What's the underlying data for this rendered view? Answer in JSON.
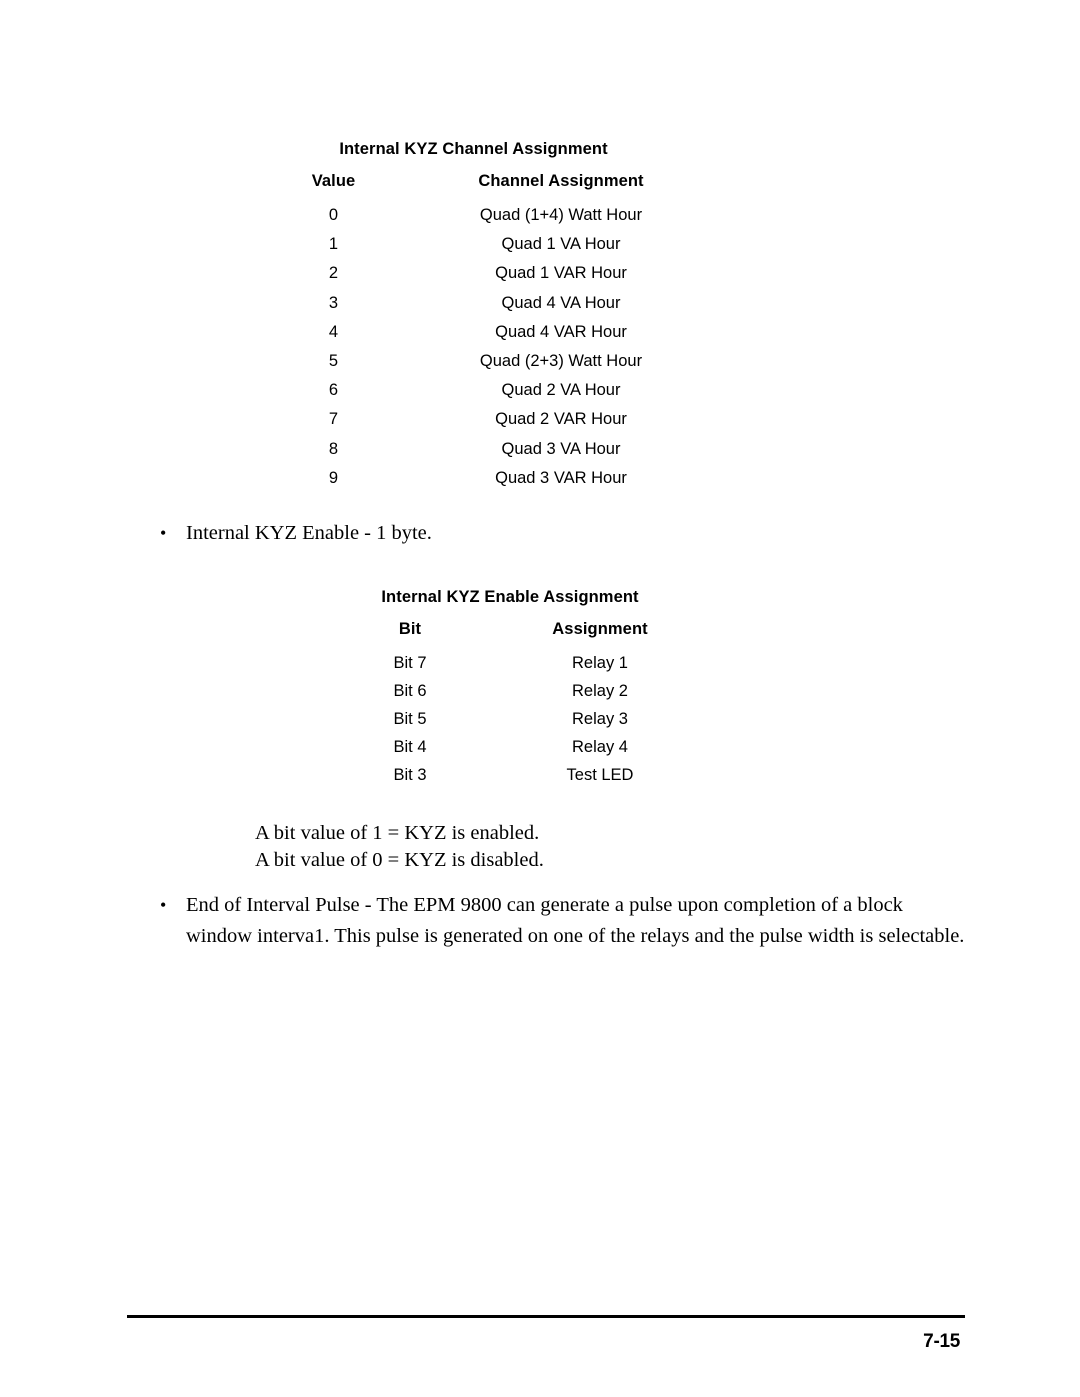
{
  "document": {
    "page_number": "7-15"
  },
  "table_channel_assignment": {
    "title": "Internal KYZ Channel Assignment",
    "headers": {
      "value": "Value",
      "assignment": "Channel Assignment"
    },
    "rows": [
      {
        "value": "0",
        "assignment": "Quad (1+4) Watt Hour"
      },
      {
        "value": "1",
        "assignment": "Quad 1 VA Hour"
      },
      {
        "value": "2",
        "assignment": "Quad 1 VAR Hour"
      },
      {
        "value": "3",
        "assignment": "Quad 4 VA Hour"
      },
      {
        "value": "4",
        "assignment": "Quad 4 VAR Hour"
      },
      {
        "value": "5",
        "assignment": "Quad (2+3) Watt Hour"
      },
      {
        "value": "6",
        "assignment": "Quad 2 VA Hour"
      },
      {
        "value": "7",
        "assignment": "Quad 2 VAR Hour"
      },
      {
        "value": "8",
        "assignment": "Quad 3 VA Hour"
      },
      {
        "value": "9",
        "assignment": "Quad 3 VAR Hour"
      }
    ]
  },
  "bullet_kyz_enable": {
    "glyph": "•",
    "text": "Internal KYZ Enable - 1 byte."
  },
  "table_enable_assignment": {
    "title": "Internal KYZ Enable Assignment",
    "headers": {
      "bit": "Bit",
      "assignment": "Assignment"
    },
    "rows": [
      {
        "bit": "Bit 7",
        "assignment": "Relay 1"
      },
      {
        "bit": "Bit 6",
        "assignment": "Relay 2"
      },
      {
        "bit": "Bit 5",
        "assignment": "Relay 3"
      },
      {
        "bit": "Bit 4",
        "assignment": "Relay 4"
      },
      {
        "bit": "Bit 3",
        "assignment": "Test LED"
      }
    ]
  },
  "para_bit_values": {
    "line1": "A bit value of 1 = KYZ is enabled.",
    "line2": "A bit value of 0 = KYZ is disabled."
  },
  "bullet_eoi_pulse": {
    "glyph": "•",
    "text": "End of Interval Pulse - The EPM 9800 can generate a pulse upon completion of a block window interva1.  This pulse is generated on one of the relays and the pulse width is selectable."
  }
}
